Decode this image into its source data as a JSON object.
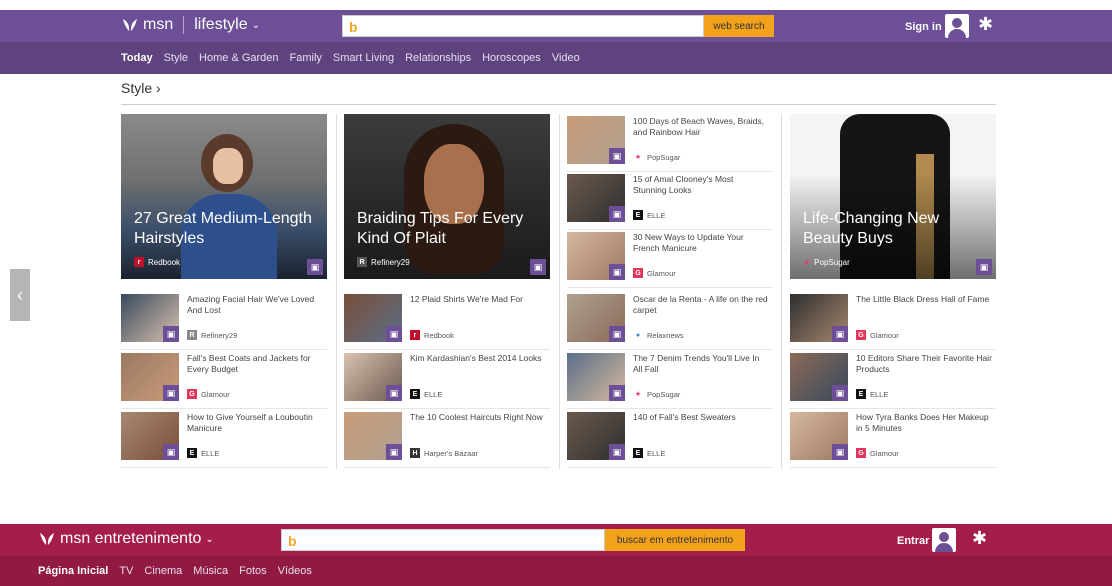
{
  "lifestyle_header": {
    "logo": "msn",
    "section": "lifestyle",
    "search_placeholder": "",
    "search_button": "web search",
    "signin": "Sign in"
  },
  "lifestyle_nav": [
    "Today",
    "Style",
    "Home & Garden",
    "Family",
    "Smart Living",
    "Relationships",
    "Horoscopes",
    "Video"
  ],
  "section_title": "Style",
  "heroes": [
    {
      "title": "27 Great Medium-Length Hairstyles",
      "source": "Redbook"
    },
    {
      "title": "Braiding Tips For Every Kind Of Plait",
      "source": "Refinery29"
    },
    {
      "title": "Life-Changing New Beauty Buys",
      "source": "PopSugar"
    }
  ],
  "col3_items": [
    {
      "title": "100 Days of Beach Waves, Braids, and Rainbow Hair",
      "source": "PopSugar"
    },
    {
      "title": "15 of Amal Clooney's Most Stunning Looks",
      "source": "ELLE"
    },
    {
      "title": "30 New Ways to Update Your French Manicure",
      "source": "Glamour"
    }
  ],
  "rows": [
    [
      {
        "title": "Amazing Facial Hair We've Loved And Lost",
        "source": "Refinery29"
      },
      {
        "title": "12 Plaid Shirts We're Mad For",
        "source": "Redbook"
      },
      {
        "title": "Oscar de la Renta - A life on the red carpet",
        "source": "Relaxnews"
      },
      {
        "title": "The Little Black Dress Hall of Fame",
        "source": "Glamour"
      }
    ],
    [
      {
        "title": "Fall's Best Coats and Jackets for Every Budget",
        "source": "Glamour"
      },
      {
        "title": "Kim Kardashian's Best 2014 Looks",
        "source": "ELLE"
      },
      {
        "title": "The 7 Denim Trends You'll Live In All Fall",
        "source": "PopSugar"
      },
      {
        "title": "10 Editors Share Their Favorite Hair Products",
        "source": "ELLE"
      }
    ],
    [
      {
        "title": "How to Give Yourself a Louboutin Manicure",
        "source": "ELLE"
      },
      {
        "title": "The 10 Coolest Haircuts Right Now",
        "source": "Harper's Bazaar"
      },
      {
        "title": "140 of Fall's Best Sweaters",
        "source": "ELLE"
      },
      {
        "title": "How Tyra Banks Does Her Makeup in 5 Minutes",
        "source": "Glamour"
      }
    ]
  ],
  "ent_header": {
    "logo": "msn entretenimento",
    "search_button": "buscar em entretenimento",
    "signin": "Entrar"
  },
  "ent_nav": [
    "Página Inicial",
    "TV",
    "Cinema",
    "Música",
    "Fotos",
    "Vídeos"
  ]
}
